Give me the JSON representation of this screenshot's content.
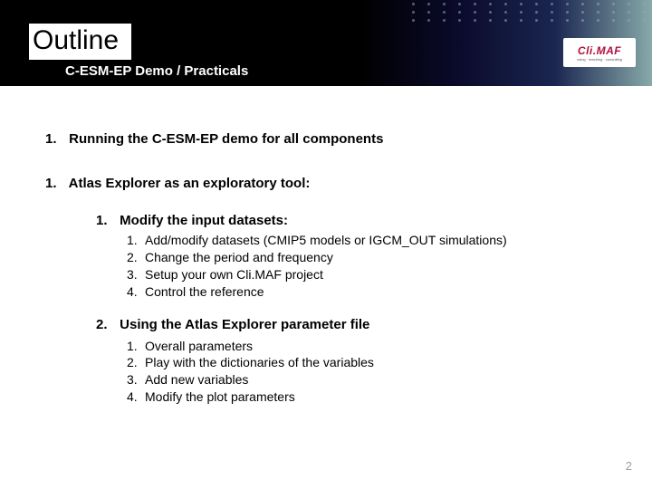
{
  "header": {
    "title": "Outline",
    "subtitle": "C-ESM-EP Demo / Practicals",
    "logo_main": "Cli.MAF",
    "logo_sub": "using · teaching · consulting"
  },
  "outline": {
    "item1": {
      "num": "1.",
      "text": "Running the C-ESM-EP demo for all components"
    },
    "item2": {
      "num": "1.",
      "text": "Atlas Explorer as an exploratory tool:",
      "sub1": {
        "num": "1.",
        "text": "Modify the input datasets:",
        "children": [
          {
            "num": "1.",
            "text": "Add/modify datasets (CMIP5 models or IGCM_OUT simulations)"
          },
          {
            "num": "2.",
            "text": "Change the period and frequency"
          },
          {
            "num": "3.",
            "text": "Setup your own Cli.MAF project"
          },
          {
            "num": "4.",
            "text": "Control the reference"
          }
        ]
      },
      "sub2": {
        "num": "2.",
        "text": "Using the Atlas Explorer parameter file",
        "children": [
          {
            "num": "1.",
            "text": "Overall parameters"
          },
          {
            "num": "2.",
            "text": "Play with the dictionaries of the variables"
          },
          {
            "num": "3.",
            "text": "Add new variables"
          },
          {
            "num": "4.",
            "text": "Modify the plot parameters"
          }
        ]
      }
    }
  },
  "page_number": "2"
}
